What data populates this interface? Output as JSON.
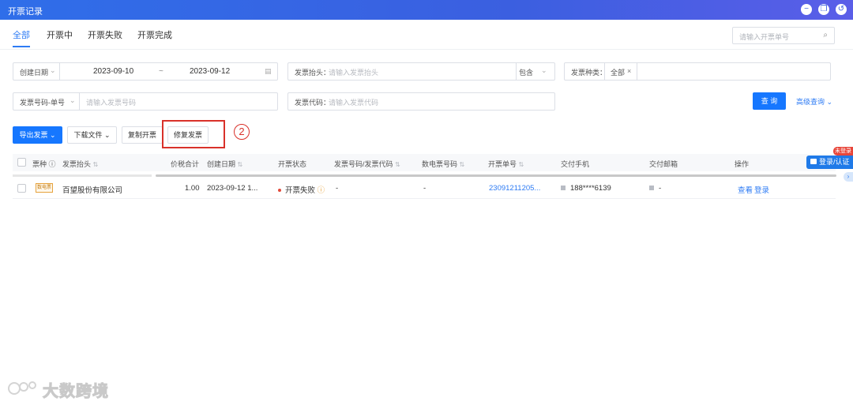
{
  "window": {
    "title": "开票记录",
    "controls": [
      "minimize-icon",
      "restore-icon",
      "back-icon"
    ]
  },
  "tabs": [
    {
      "label": "全部",
      "active": true
    },
    {
      "label": "开票中",
      "active": false
    },
    {
      "label": "开票失败",
      "active": false
    },
    {
      "label": "开票完成",
      "active": false
    }
  ],
  "top_search": {
    "placeholder": "请输入开票单号",
    "icon": "search-icon"
  },
  "filters": {
    "date": {
      "type_label": "创建日期",
      "start": "2023-09-10",
      "separator": "~",
      "end": "2023-09-12",
      "icon": "calendar-icon"
    },
    "title": {
      "label": "发票抬头：",
      "placeholder": "请输入发票抬头",
      "match": "包含"
    },
    "kind": {
      "label": "发票种类：",
      "tag": "全部",
      "tag_close": "×"
    },
    "number": {
      "type_label": "发票号码-单号",
      "placeholder": "请输入发票号码"
    },
    "code": {
      "label": "发票代码：",
      "placeholder": "请输入发票代码"
    },
    "query_button": "查 询",
    "advanced": "高级查询"
  },
  "actions": {
    "export": "导出发票",
    "download": "下载文件",
    "copy": "复制开票",
    "repair": "修复发票"
  },
  "annotation": {
    "number": "2"
  },
  "table": {
    "headers": [
      "票种",
      "发票抬头",
      "价税合计",
      "创建日期",
      "开票状态",
      "发票号码/发票代码",
      "数电票号码",
      "开票单号",
      "交付手机",
      "交付邮箱",
      "操作"
    ],
    "rows": [
      {
        "type_tag": "数电票",
        "title": "百望股份有限公司",
        "amount": "1.00",
        "created": "2023-09-12 1...",
        "status": "开票失败",
        "status_color": "#e24a3b",
        "number_code": "-",
        "digital_number": "-",
        "order_no": "23091211205...",
        "phone": "188****6139",
        "email": "-",
        "ops": [
          "查看",
          "登录"
        ]
      }
    ]
  },
  "float": {
    "login": "登录/认证",
    "badge": "未登录"
  },
  "watermark": {
    "text": "大数跨境"
  }
}
